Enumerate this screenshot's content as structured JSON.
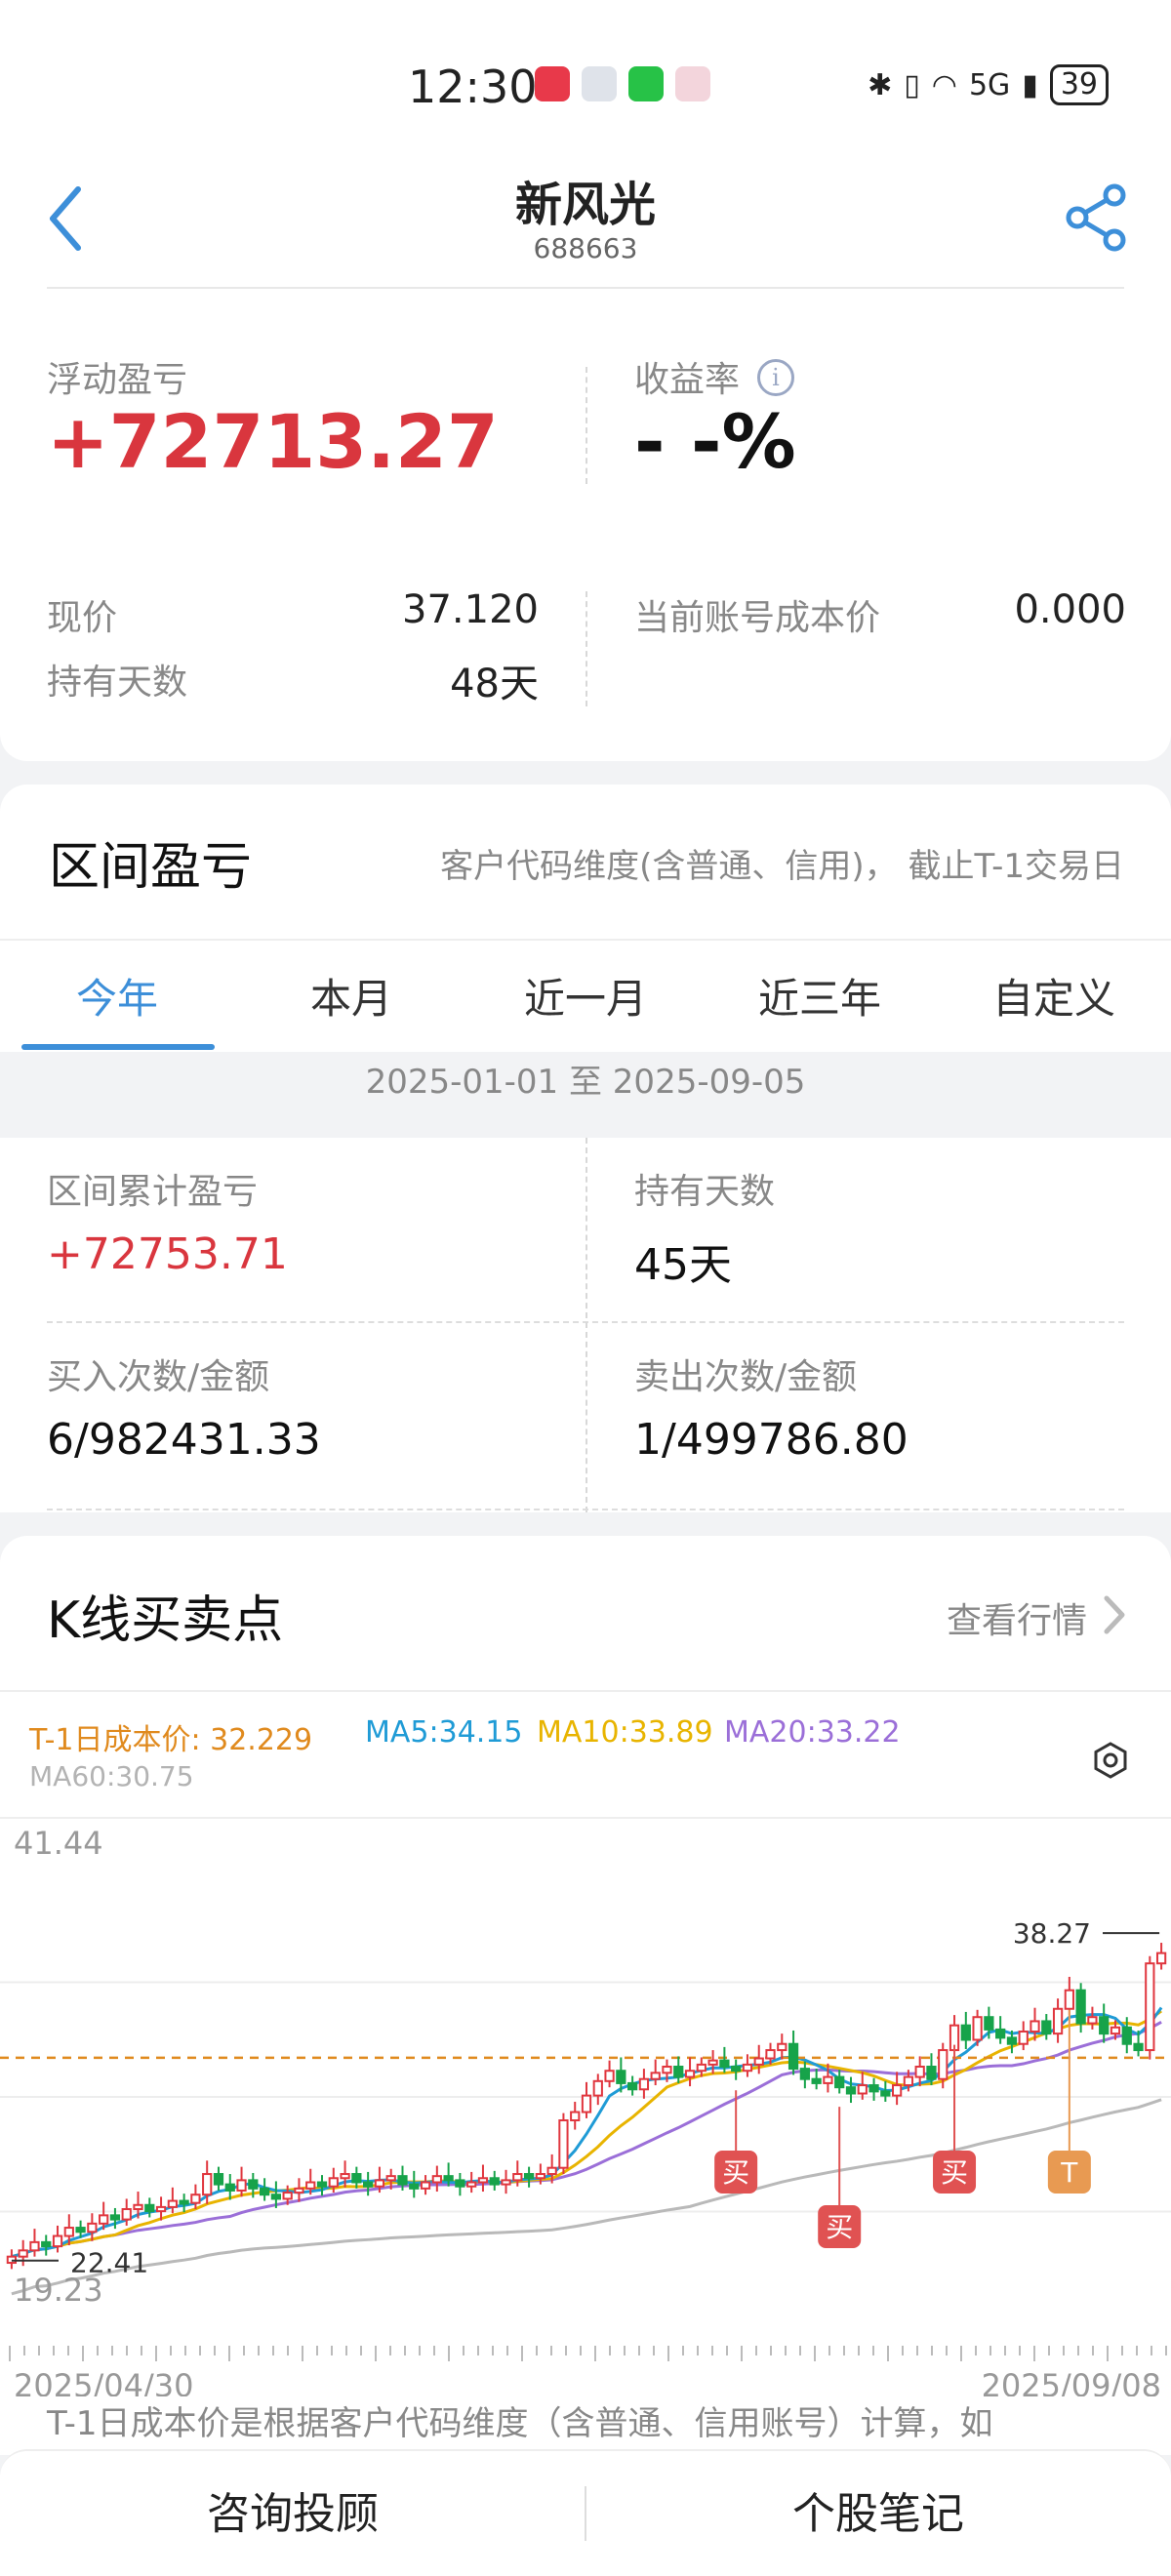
{
  "status_bar": {
    "time": "12:30",
    "battery": "39",
    "network": "5G"
  },
  "header": {
    "title": "新风光",
    "code": "688663"
  },
  "summary": {
    "float_pnl_label": "浮动盈亏",
    "float_pnl_value": "+72713.27",
    "rate_label": "收益率",
    "rate_value": "- -%",
    "price_label": "现价",
    "price_value": "37.120",
    "hold_days_label": "持有天数",
    "hold_days_value": "48天",
    "cost_label": "当前账号成本价",
    "cost_value": "0.000"
  },
  "range": {
    "title": "区间盈亏",
    "note": "客户代码维度(含普通、信用)， 截止T-1交易日",
    "tabs": [
      "今年",
      "本月",
      "近一月",
      "近三年",
      "自定义"
    ],
    "active_tab": 0,
    "date_range": "2025-01-01 至 2025-09-05",
    "cum_pnl_label": "区间累计盈亏",
    "cum_pnl_value": "+72753.71",
    "hold_days_label": "持有天数",
    "hold_days_value": "45天",
    "buy_label": "买入次数/金额",
    "buy_value": "6/982431.33",
    "sell_label": "卖出次数/金额",
    "sell_value": "1/499786.80"
  },
  "kline": {
    "title": "K线买卖点",
    "view_link": "查看行情",
    "legend": {
      "cost": "T-1日成本价: 32.229",
      "ma5": "MA5:34.15",
      "ma10": "MA10:33.89",
      "ma20": "MA20:33.22",
      "ma60": "MA60:30.75"
    },
    "colors": {
      "cost": "#e08a1e",
      "ma5": "#1f9bd6",
      "ma10": "#e8b400",
      "ma20": "#9b6fd8",
      "ma60": "#b9b9b9",
      "up": "#e0363e",
      "down": "#17a34a"
    },
    "footnote": "T-1日成本价是根据客户代码维度（含普通、信用账号）计算，如"
  },
  "chart_data": {
    "type": "candlestick",
    "y_top_label": "41.44",
    "y_bottom_label": "19.23",
    "ylim": [
      19.23,
      41.44
    ],
    "x_start_label": "2025/04/30",
    "x_end_label": "2025/09/08",
    "high_label": "38.27",
    "low_label": "22.41",
    "cost_line": 32.229,
    "close": [
      22.6,
      22.9,
      23.3,
      23.1,
      23.6,
      24.0,
      23.8,
      24.2,
      24.6,
      24.4,
      24.9,
      25.1,
      24.8,
      25.0,
      25.3,
      25.2,
      25.6,
      26.6,
      26.1,
      25.8,
      26.3,
      25.9,
      25.6,
      25.4,
      25.7,
      25.9,
      26.2,
      26.0,
      26.4,
      26.6,
      26.2,
      26.0,
      26.3,
      26.5,
      26.1,
      25.9,
      26.2,
      26.5,
      26.3,
      26.0,
      26.2,
      26.4,
      26.1,
      26.3,
      26.6,
      26.4,
      26.6,
      26.9,
      29.2,
      29.6,
      30.4,
      31.1,
      31.6,
      31.0,
      30.7,
      31.2,
      31.5,
      31.8,
      31.3,
      31.6,
      31.9,
      32.1,
      31.8,
      31.6,
      31.9,
      32.2,
      32.6,
      32.9,
      31.7,
      31.2,
      31.0,
      31.3,
      30.8,
      30.5,
      30.9,
      30.6,
      30.4,
      30.9,
      31.3,
      31.8,
      31.2,
      32.6,
      33.8,
      33.1,
      34.2,
      33.6,
      33.2,
      32.9,
      33.5,
      34.0,
      33.4,
      34.6,
      35.5,
      33.9,
      34.2,
      33.4,
      33.7,
      32.9,
      32.6,
      36.8,
      37.3
    ],
    "events": [
      {
        "label": "买",
        "index": 63
      },
      {
        "label": "买",
        "index": 72
      },
      {
        "label": "买",
        "index": 82
      },
      {
        "label": "T",
        "index": 92
      }
    ]
  },
  "bottom_bar": {
    "consult": "咨询投顾",
    "notes": "个股笔记"
  }
}
